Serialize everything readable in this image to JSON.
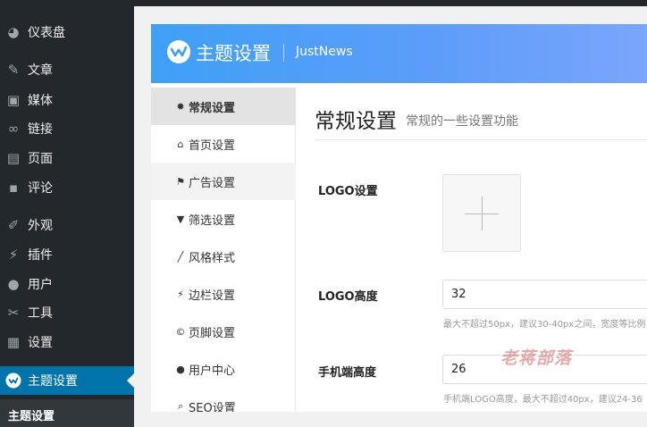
{
  "wp_menu": [
    {
      "label": "仪表盘",
      "icon": "dashboard-icon"
    },
    {
      "label": "文章",
      "icon": "pin-icon"
    },
    {
      "label": "媒体",
      "icon": "media-icon"
    },
    {
      "label": "链接",
      "icon": "link-icon"
    },
    {
      "label": "页面",
      "icon": "page-icon"
    },
    {
      "label": "评论",
      "icon": "comment-icon"
    },
    {
      "label": "外观",
      "icon": "brush-icon"
    },
    {
      "label": "插件",
      "icon": "plugin-icon"
    },
    {
      "label": "用户",
      "icon": "user-icon"
    },
    {
      "label": "工具",
      "icon": "wrench-icon"
    },
    {
      "label": "设置",
      "icon": "settings-icon"
    },
    {
      "label": "主题设置",
      "icon": "theme-logo-icon"
    }
  ],
  "wp_submenu": {
    "active": "主题设置"
  },
  "panel": {
    "title": "主题设置",
    "subtitle": "JustNews",
    "menu": [
      {
        "label": "常规设置",
        "icon": "gear-icon"
      },
      {
        "label": "首页设置",
        "icon": "home-icon"
      },
      {
        "label": "广告设置",
        "icon": "flag-icon"
      },
      {
        "label": "筛选设置",
        "icon": "filter-icon"
      },
      {
        "label": "风格样式",
        "icon": "magic-wand-icon"
      },
      {
        "label": "边栏设置",
        "icon": "plug-icon"
      },
      {
        "label": "页脚设置",
        "icon": "copyright-icon"
      },
      {
        "label": "用户中心",
        "icon": "user-icon"
      },
      {
        "label": "SEO设置",
        "icon": "search-icon"
      }
    ]
  },
  "content": {
    "title": "常规设置",
    "description": "常规的一些设置功能",
    "logo_label": "LOGO设置",
    "logo_height_label": "LOGO高度",
    "logo_height_value": "32",
    "logo_height_hint": "最大不超过50px，建议30-40px之间，宽度等比例",
    "mobile_height_label": "手机端高度",
    "mobile_height_value": "26",
    "mobile_height_hint": "手机端LOGO高度，最大不超过40px，建议24-36"
  },
  "watermark": "老蒋部落",
  "colors": {
    "wp_sidebar": "#23282d",
    "wp_active": "#0073aa",
    "header_gradient_start": "#3fa0f5",
    "header_gradient_end": "#7aa6fb"
  }
}
